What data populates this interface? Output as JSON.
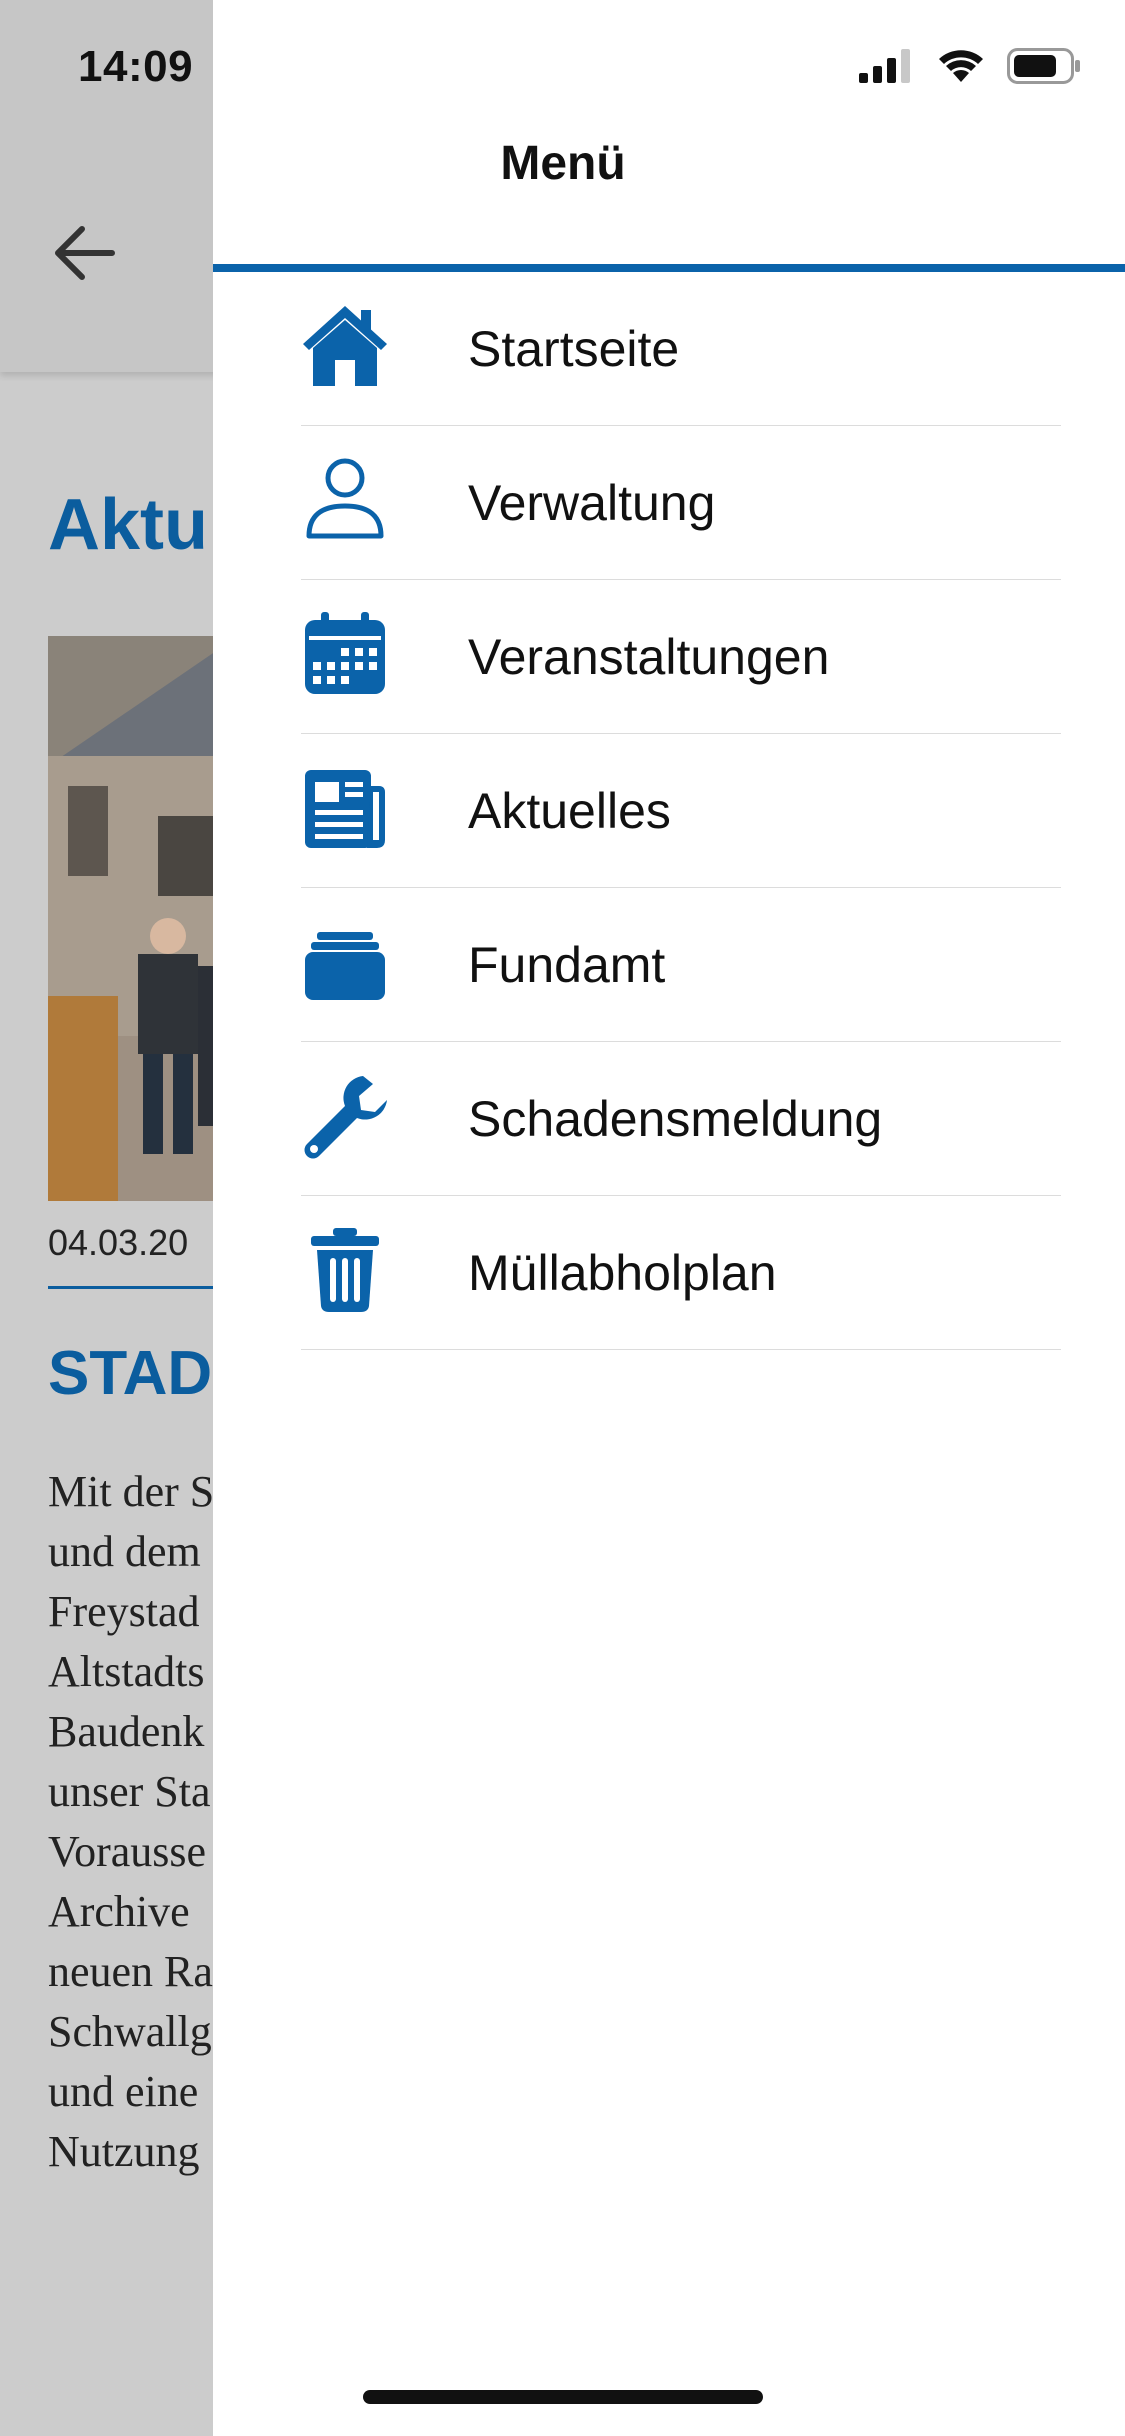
{
  "status_bar": {
    "time": "14:09"
  },
  "background_page": {
    "heading": "Aktu",
    "date": "04.03.20",
    "title": "STAD",
    "body_lines": [
      "Mit der S",
      "und dem",
      "Freystad",
      "Altstadts",
      "Baudenk",
      "unser Sta",
      "Vorausse",
      "Archive",
      "neuen Ra",
      "Schwallg",
      "und eine",
      "Nutzung"
    ]
  },
  "drawer": {
    "title": "Menü",
    "accent_color": "#0b63aa",
    "items": [
      {
        "label": "Startseite",
        "icon": "home-icon"
      },
      {
        "label": "Verwaltung",
        "icon": "person-icon"
      },
      {
        "label": "Veranstaltungen",
        "icon": "calendar-icon"
      },
      {
        "label": "Aktuelles",
        "icon": "newspaper-icon"
      },
      {
        "label": "Fundamt",
        "icon": "box-icon"
      },
      {
        "label": "Schadensmeldung",
        "icon": "wrench-icon"
      },
      {
        "label": "Müllabholplan",
        "icon": "trash-icon"
      }
    ]
  }
}
